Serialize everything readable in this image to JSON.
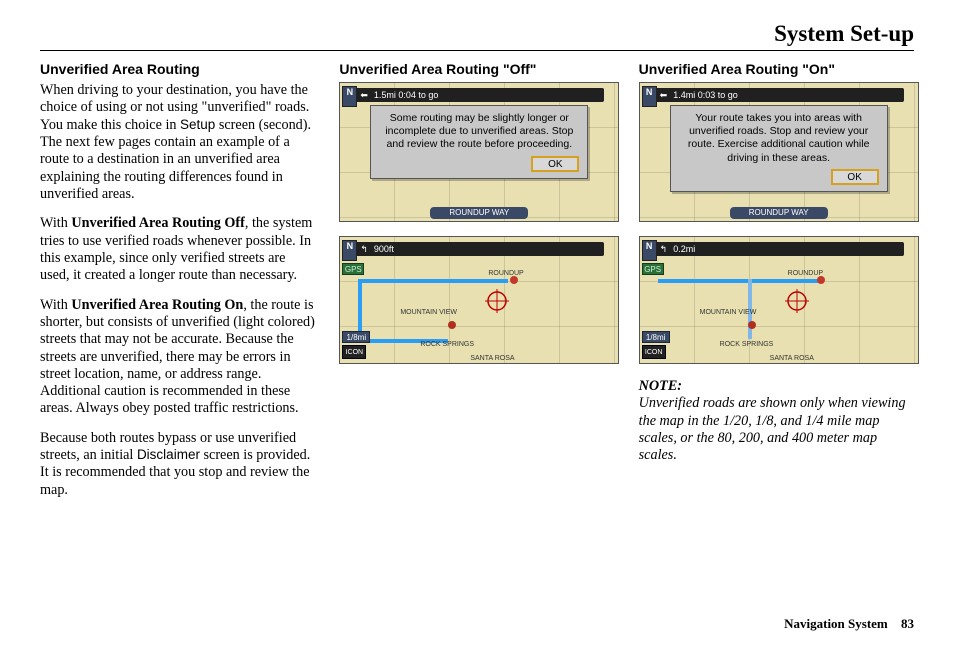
{
  "page": {
    "title": "System Set-up",
    "footer_label": "Navigation System",
    "footer_page": "83"
  },
  "col1": {
    "heading": "Unverified Area Routing",
    "p1a": "When driving to your destination, you have the choice of using or not using \"unverified\" roads. You make this choice in ",
    "p1_setup": "Setup",
    "p1b": " screen (second). The next few pages contain an example of a route to a destination in an unverified area explaining the routing differences found in unverified areas.",
    "p2a": "With ",
    "p2_bold": "Unverified Area Routing Off",
    "p2b": ", the system tries to use verified roads whenever possible. In this example, since only verified streets are used, it created a longer route than necessary.",
    "p3a": "With ",
    "p3_bold": "Unverified Area Routing On",
    "p3b": ", the route is shorter, but consists of unverified (light colored) streets that may not be accurate. Because the streets are unverified, there may be errors in street location, name, or address range. Additional caution is recommended in these areas. Always obey posted traffic restrictions.",
    "p4a": "Because both routes bypass or use unverified streets, an initial ",
    "p4_disc": "Disclaimer",
    "p4b": " screen is provided. It is recommended that you stop and review the map."
  },
  "col2": {
    "heading": "Unverified Area Routing \"Off\"",
    "shot1": {
      "topbar": "1.5mi  0:04 to go",
      "dialog": "Some routing may be slightly longer or incomplete due to unverified areas. Stop and review the route before proceeding.",
      "ok": "OK",
      "street": "ROUNDUP WAY"
    },
    "shot2": {
      "topbar": "900ft",
      "scale": "1/8mi",
      "icon": "ICON",
      "gps": "GPS",
      "labels": {
        "roundup": "ROUNDUP",
        "mtn": "MOUNTAIN VIEW",
        "rock": "ROCK SPRINGS",
        "rosa": "SANTA ROSA"
      }
    }
  },
  "col3": {
    "heading": "Unverified Area Routing \"On\"",
    "shot1": {
      "topbar": "1.4mi  0:03 to go",
      "dialog": "Your route takes you into areas with unverified roads. Stop and review your route. Exercise additional caution while driving in these areas.",
      "ok": "OK",
      "street": "ROUNDUP WAY"
    },
    "shot2": {
      "topbar": "0.2mi",
      "scale": "1/8mi",
      "icon": "ICON",
      "gps": "GPS",
      "labels": {
        "roundup": "ROUNDUP",
        "mtn": "MOUNTAIN VIEW",
        "rock": "ROCK SPRINGS",
        "rosa": "SANTA ROSA"
      }
    },
    "note_label": "NOTE:",
    "note_body": "Unverified roads are shown only when viewing the map in the 1/20, 1/8, and 1/4 mile map scales, or the 80, 200, and 400 meter map scales."
  }
}
